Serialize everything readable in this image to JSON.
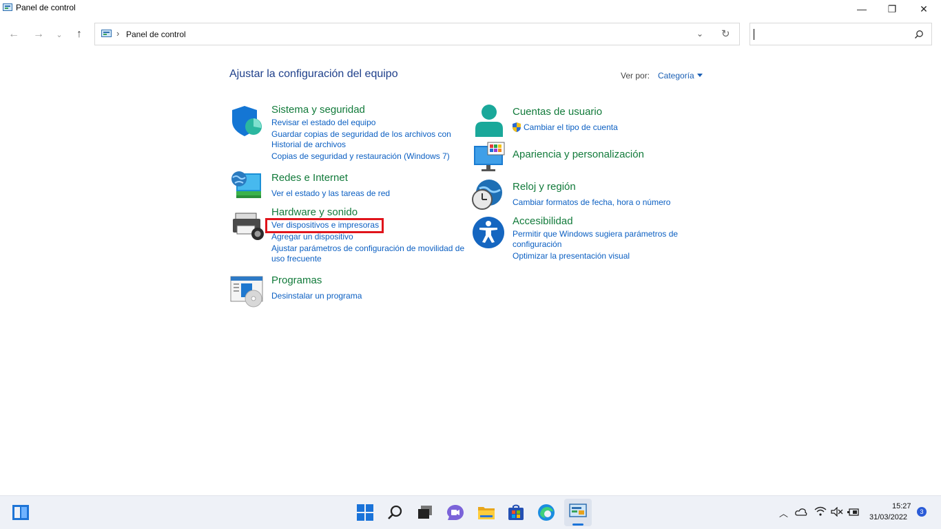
{
  "window": {
    "title": "Panel de control",
    "minimize_glyph": "—",
    "maximize_glyph": "❐",
    "close_glyph": "✕"
  },
  "address_bar": {
    "path": "Panel de control",
    "separator": "›",
    "search_placeholder": ""
  },
  "header": {
    "heading": "Ajustar la configuración del equipo",
    "view_by_label": "Ver por:",
    "view_by_value": "Categoría"
  },
  "categories": {
    "system": {
      "title": "Sistema y seguridad",
      "links": [
        "Revisar el estado del equipo",
        "Guardar copias de seguridad de los archivos con",
        "Historial de archivos",
        "Copias de seguridad y restauración (Windows 7)"
      ]
    },
    "network": {
      "title": "Redes e Internet",
      "links": [
        "Ver el estado y las tareas de red"
      ]
    },
    "hardware": {
      "title": "Hardware y sonido",
      "links": [
        "Ver dispositivos e impresoras",
        "Agregar un dispositivo",
        "Ajustar parámetros de configuración de movilidad de",
        "uso frecuente"
      ]
    },
    "programs": {
      "title": "Programas",
      "links": [
        "Desinstalar un programa"
      ]
    },
    "accounts": {
      "title": "Cuentas de usuario",
      "links": [
        "Cambiar el tipo de cuenta"
      ]
    },
    "appearance": {
      "title": "Apariencia y personalización",
      "links": []
    },
    "clock": {
      "title": "Reloj y región",
      "links": [
        "Cambiar formatos de fecha, hora o número"
      ]
    },
    "accessibility": {
      "title": "Accesibilidad",
      "links": [
        "Permitir que Windows sugiera parámetros de",
        "configuración",
        "Optimizar la presentación visual"
      ]
    }
  },
  "taskbar": {
    "time": "15:27",
    "date": "31/03/2022",
    "notification_count": "3",
    "icons": [
      "widgets-icon",
      "start-icon",
      "search-icon",
      "task-view-icon",
      "chat-icon",
      "file-explorer-icon",
      "store-icon",
      "edge-icon",
      "control-panel-icon"
    ]
  },
  "colors": {
    "category_title": "#117a3a",
    "link": "#0b5fc2",
    "heading": "#1e3f8a",
    "highlight_border": "#e0141b",
    "taskbar": "#eef1f7"
  }
}
